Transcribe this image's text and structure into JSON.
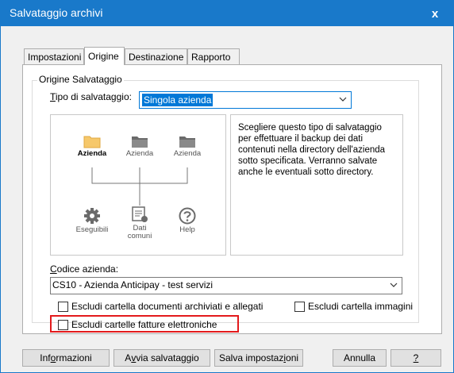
{
  "window": {
    "title": "Salvataggio archivi",
    "close_glyph": "x"
  },
  "tabs": [
    {
      "label": "Impostazioni",
      "active": false
    },
    {
      "label": "Origine",
      "active": true
    },
    {
      "label": "Destinazione",
      "active": false
    },
    {
      "label": "Rapporto",
      "active": false
    }
  ],
  "group": {
    "legend": "Origine Salvataggio"
  },
  "tipo": {
    "label_accel": "T",
    "label_rest": "ipo di salvataggio:",
    "value": "Singola azienda"
  },
  "diagram": {
    "nodes": {
      "azienda_active": "Azienda",
      "azienda_2": "Azienda",
      "azienda_3": "Azienda",
      "eseguibili": "Eseguibili",
      "dati_comuni_1": "Dati",
      "dati_comuni_2": "comuni",
      "help": "Help"
    }
  },
  "description": "Scegliere questo tipo di salvataggio per effettuare il backup dei dati contenuti nella directory dell'azienda sotto specificata. Verranno salvate anche le eventuali sotto directory.",
  "codice": {
    "label_accel": "C",
    "label_rest": "odice azienda:",
    "value": "CS10 - Azienda Anticipay - test servizi"
  },
  "checks": {
    "documenti": "Escludi cartella documenti archiviati e allegati",
    "immagini": "Escludi cartella immagini",
    "fatture": "Escludi cartelle fatture elettroniche"
  },
  "buttons": {
    "informazioni_pre": "Inf",
    "informazioni_accel": "o",
    "informazioni_post": "rmazioni",
    "avvia_pre": "A",
    "avvia_accel": "v",
    "avvia_post": "via salvataggio",
    "salva_pre": "Salva impostaz",
    "salva_accel": "i",
    "salva_post": "oni",
    "annulla": "Annulla",
    "help": "?"
  },
  "colors": {
    "titlebar": "#1979ca",
    "selection": "#0078d7",
    "highlight_frame": "#e31a1c",
    "folder_active": "#f6c86b",
    "icon_gray": "#6b6b6b"
  }
}
